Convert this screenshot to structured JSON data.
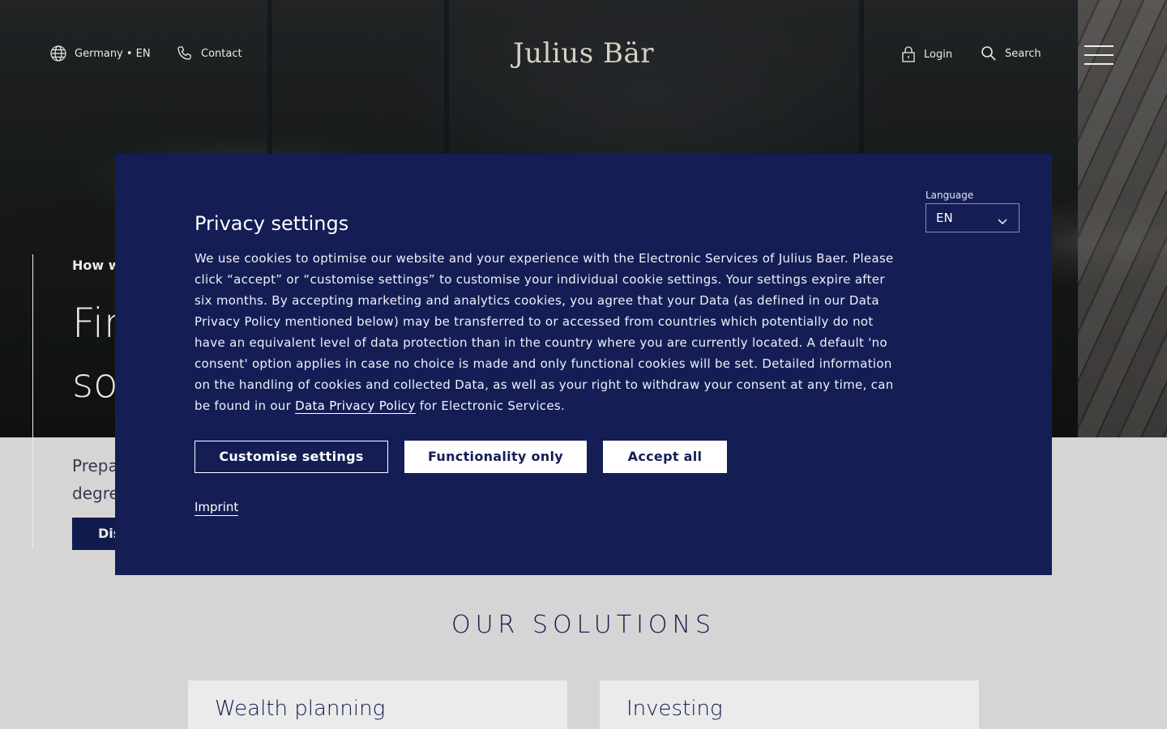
{
  "header": {
    "region_label": "Germany • EN",
    "contact_label": "Contact",
    "logo_text": "Julius Bär",
    "login_label": "Login",
    "search_label": "Search",
    "icons": [
      "globe-icon",
      "phone-icon",
      "lock-icon",
      "search-icon",
      "menu-icon"
    ]
  },
  "hero": {
    "kicker": "How w",
    "headline": "Fin\nso",
    "subtext": "Prepa\ndegre",
    "cta_label": "Dis"
  },
  "solutions": {
    "title": "OUR SOLUTIONS",
    "cards": [
      "Wealth planning",
      "Investing"
    ]
  },
  "privacy_modal": {
    "title": "Privacy settings",
    "body_before_link": "We use cookies to optimise our website and your experience with the Electronic Services of Julius Baer. Please click “accept” or “customise settings” to customise your individual cookie settings. Your settings expire after six months. By accepting marketing and analytics cookies, you agree that your Data (as defined in our Data Privacy Policy mentioned below) may be transferred to or accessed from countries which potentially do not have an equivalent level of data protection than in the country where you are currently located. A default 'no consent' option applies in case no choice is made and only functional cookies will be set. Detailed information on the handling of cookies and collected Data, as well as your right to withdraw your consent at any time, can be found in our ",
    "link_text": "Data Privacy Policy",
    "body_after_link": " for Electronic Services.",
    "language_label": "Language",
    "language_value": "EN",
    "buttons": {
      "customise": "Customise settings",
      "functionality": "Functionality only",
      "accept": "Accept all"
    },
    "imprint_label": "Imprint"
  },
  "colors": {
    "brand_navy": "#141e55",
    "logo": "#e7e2d4",
    "page_bg": "#e8e8e8"
  }
}
